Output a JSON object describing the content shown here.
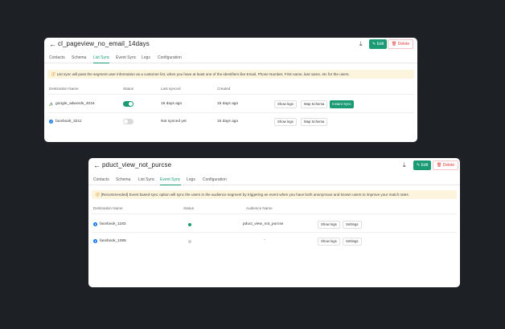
{
  "panel1": {
    "title": "cl_pageview_no_email_14days",
    "edit_label": "Edit",
    "delete_label": "Delete",
    "tabs": [
      "Contacts",
      "Schema",
      "List Sync",
      "Event Sync",
      "Logs",
      "Configuration"
    ],
    "active_tab": "List Sync",
    "note": "List sync will pass the segment user information as a customer list, when you have at least one of the identifiers like Email, Phone Number, First name, last name, etc for the users.",
    "columns": [
      "Destination Name",
      "Status",
      "Last synced",
      "Created"
    ],
    "rows": [
      {
        "name": "google_adwords_4016",
        "status": "on",
        "last_synced": "15 days ago",
        "created": "15 days ago",
        "buttons": [
          "Show logs",
          "Map Schema",
          "Instant Sync"
        ]
      },
      {
        "name": "facebook_3211",
        "status": "off",
        "last_synced": "Not synced yet",
        "created": "15 days ago",
        "buttons": [
          "Show logs",
          "Map Schema"
        ]
      }
    ],
    "colors": {
      "accent": "#1a9b74",
      "delete": "#e03c3c",
      "note_bg": "#fdf4de"
    }
  },
  "panel2": {
    "title": "pduct_view_not_purcse",
    "edit_label": "Edit",
    "delete_label": "Delete",
    "tabs": [
      "Contacts",
      "Schema",
      "List Sync",
      "Event Sync",
      "Logs",
      "Configuration"
    ],
    "active_tab": "Event Sync",
    "note": "[Recommended] Event based sync option will sync the users in the audience segment by triggering an event when you have both anonymous and known users to improve your match rates.",
    "columns": [
      "Destination Name",
      "Status",
      "Audience Name"
    ],
    "rows": [
      {
        "name": "facebook_1183",
        "status": "active",
        "audience": "pduct_view_not_purcse",
        "buttons": [
          "Show logs",
          "Settings"
        ]
      },
      {
        "name": "facebook_1085",
        "status": "inactive",
        "audience": "-",
        "buttons": [
          "Show logs",
          "Settings"
        ]
      }
    ]
  },
  "icons": {
    "back": "arrow-left-icon",
    "download": "download-icon",
    "edit": "edit-icon",
    "delete": "trash-icon",
    "info": "info-icon",
    "google_ads": "google-ads-icon",
    "facebook": "facebook-icon"
  }
}
